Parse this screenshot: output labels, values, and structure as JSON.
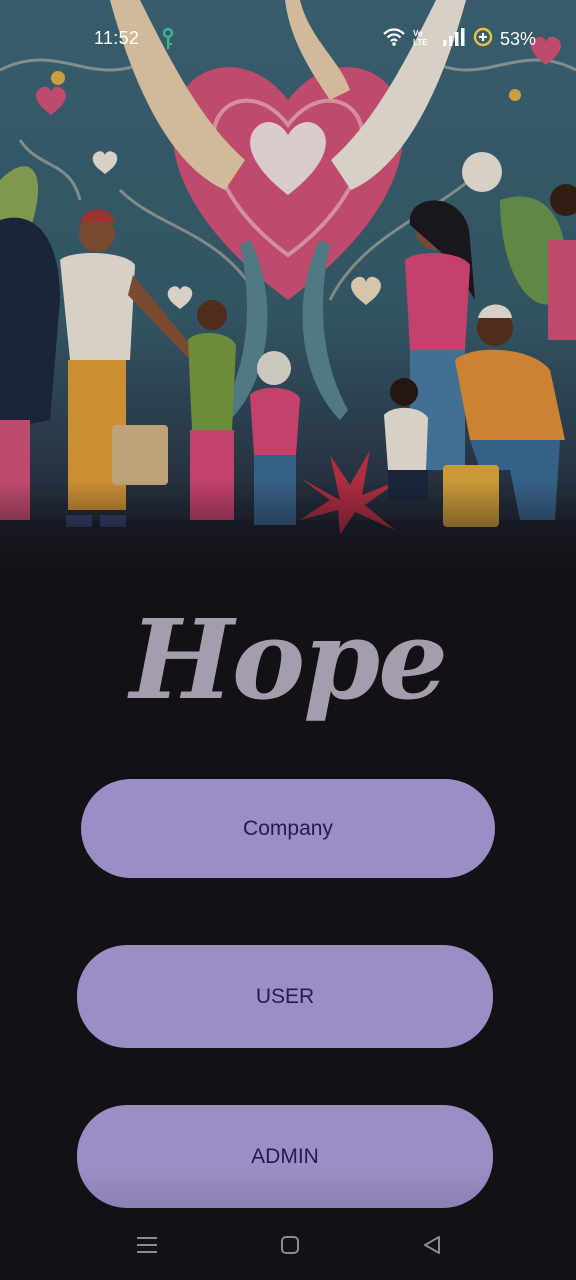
{
  "status_bar": {
    "time": "11:52",
    "volte_label": "Vo LTE",
    "battery_percent": "53%"
  },
  "app": {
    "title": "Hope"
  },
  "buttons": {
    "company": "Company",
    "user": "USER",
    "admin": "ADMIN"
  },
  "icons": {
    "status": [
      "key-icon",
      "wifi-icon",
      "volte-icon",
      "signal-icon",
      "battery-saver-icon"
    ],
    "nav": [
      "menu-icon",
      "home-icon",
      "back-icon"
    ]
  },
  "colors": {
    "background": "#131016",
    "button": "#9b8ec4",
    "button_text": "#2a1752",
    "title": "#a49eac"
  }
}
